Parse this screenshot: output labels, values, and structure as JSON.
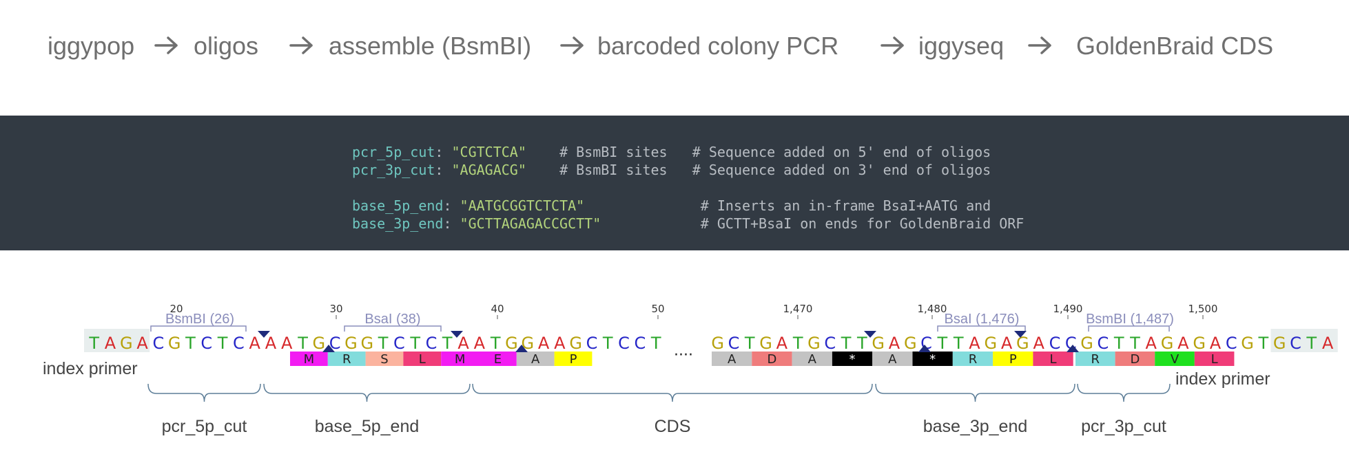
{
  "pipeline": {
    "steps": [
      "iggypop",
      "oligos",
      "assemble (BsmBI)",
      "barcoded colony PCR",
      "iggyseq",
      "GoldenBraid CDS"
    ]
  },
  "config": {
    "lines": [
      {
        "key": "pcr_5p_cut",
        "value": "\"CGTCTCA\"",
        "pad": "   ",
        "comment1": "# BsmBI sites",
        "comment2": "# Sequence added on 5' end of oligos"
      },
      {
        "key": "pcr_3p_cut",
        "value": "\"AGAGACG\"",
        "pad": "   ",
        "comment1": "# BsmBI sites",
        "comment2": "# Sequence added on 3' end of oligos"
      },
      {
        "key": "base_5p_end",
        "value": "\"AATGCGGTCTCTA\"",
        "pad": "",
        "comment1": "",
        "comment2": "# Inserts an in-frame BsaI+AATG and"
      },
      {
        "key": "base_3p_end",
        "value": "\"GCTTAGAGACCGCTT\"",
        "pad": "",
        "comment1": "",
        "comment2": "# GCTT+BsaI on ends for GoldenBraid ORF"
      }
    ]
  },
  "sequence_map": {
    "ruler_left": [
      "20",
      "30",
      "40",
      "50"
    ],
    "ruler_right": [
      "1,470",
      "1,480",
      "1,490",
      "1,500"
    ],
    "seq_left": "TAGACGTCTCAAATGCGGTCTCTAATGGAAGCTCCT",
    "seq_right": "GCTGATGCTTGAGCTTAGAGACCGCTTAGAGACGTGCTA",
    "aa_left": [
      "M",
      "R",
      "S",
      "L",
      "M",
      "E",
      "A",
      "P"
    ],
    "aa_right_a": [
      "A",
      "D",
      "A",
      "*",
      "A",
      "*",
      "R",
      "P",
      "L"
    ],
    "aa_right_b": [
      "R",
      "D",
      "V",
      "L"
    ],
    "ellipsis": "····",
    "sites": [
      "BsmBI (26)",
      "BsaI (38)",
      "BsaI (1,476)",
      "BsmBI (1,487)"
    ],
    "flank_labels": [
      "index primer",
      "index primer"
    ],
    "regions": [
      "pcr_5p_cut",
      "base_5p_end",
      "CDS",
      "base_3p_end",
      "pcr_3p_cut"
    ],
    "base_colors": {
      "A": "#d6282b",
      "T": "#2aa52a",
      "G": "#b7a10a",
      "C": "#2626c8"
    },
    "aa_colors": {
      "M": "#f21cf2",
      "R": "#82dcdc",
      "S": "#fbb39e",
      "L": "#f03c78",
      "E": "#f21cf2",
      "A": "#c3c3c3",
      "P": "#ffff00",
      "D": "#ef7c7c",
      "V": "#1fe01f",
      "*": "#000000"
    },
    "site_color": "#8a8dbb",
    "bracket_color": "#5d7e98"
  }
}
